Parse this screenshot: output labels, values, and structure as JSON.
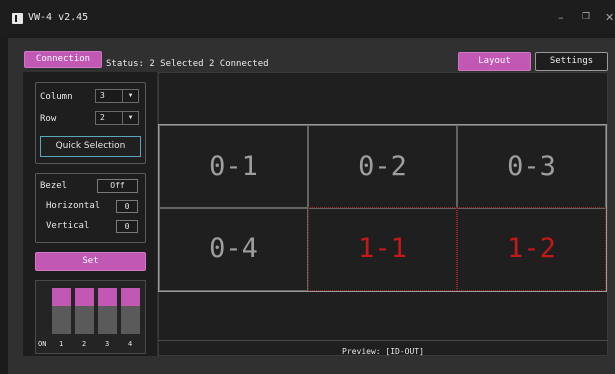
{
  "window": {
    "title": "VW-4 v2.45",
    "minimize_glyph": "–",
    "maximize_glyph": "❐",
    "close_glyph": "✕"
  },
  "toolbar": {
    "connection_label": "Connection",
    "status_text": "Status: 2 Selected 2 Connected",
    "layout_label": "Layout",
    "settings_label": "Settings"
  },
  "sidebar": {
    "column_label": "Column",
    "column_value": "3",
    "row_label": "Row",
    "row_value": "2",
    "quick_selection_label": "Quick Selection",
    "bezel_label": "Bezel",
    "bezel_value": "Off",
    "horizontal_label": "Horizontal",
    "horizontal_value": "0",
    "vertical_label": "Vertical",
    "vertical_value": "0",
    "set_label": "Set",
    "dip_on_label": "ON",
    "dip_numbers": [
      "1",
      "2",
      "3",
      "4"
    ]
  },
  "grid": {
    "cells": [
      "0-1",
      "0-2",
      "0-3",
      "0-4",
      "1-1",
      "1-2"
    ],
    "connected_cells": [
      "1-1",
      "1-2"
    ]
  },
  "preview_label": "Preview: [ID-OUT]",
  "colors": {
    "accent": "#c158b3",
    "connected": "#c61818",
    "quick_border": "#58a9bd"
  }
}
